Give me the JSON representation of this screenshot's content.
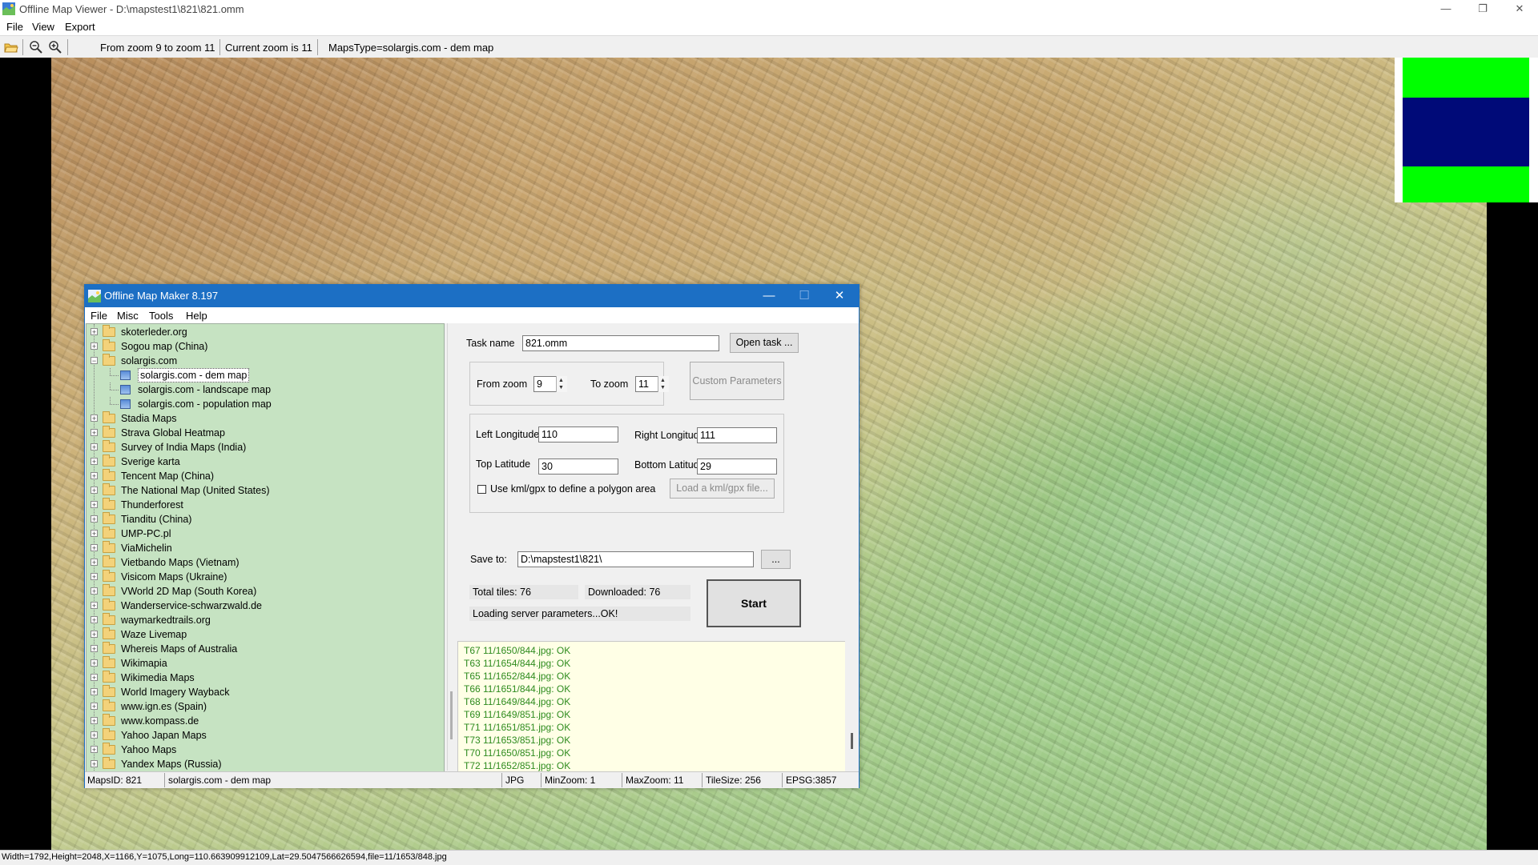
{
  "window": {
    "title": "Offline Map Viewer - D:\\mapstest1\\821\\821.omm",
    "controls": {
      "minimize": "—",
      "maximize": "❐",
      "close": "✕"
    }
  },
  "menu": {
    "file": "File",
    "view": "View",
    "export": "Export"
  },
  "toolbar": {
    "zoom_range": "From zoom 9 to zoom 11",
    "current_zoom": "Current zoom is 11",
    "maps_type": "MapsType=solargis.com - dem map"
  },
  "statusbar": {
    "text": "Width=1792,Height=2048,X=1166,Y=1075,Long=110.663909912109,Lat=29.5047566626594,file=11/1653/848.jpg"
  },
  "overview_colors": {
    "top": "#00ff00",
    "middle": "#000a78",
    "bottom": "#00ff00"
  },
  "dialog": {
    "title": "Offline Map Maker 8.197",
    "controls": {
      "minimize": "—",
      "maximize": "☐",
      "close": "✕"
    },
    "menu": {
      "file": "File",
      "misc": "Misc",
      "tools": "Tools",
      "help": "Help"
    },
    "tree": {
      "items": [
        {
          "label": "skoterleder.org"
        },
        {
          "label": "Sogou map (China)"
        },
        {
          "label": "solargis.com",
          "expanded": true
        },
        {
          "label": "solargis.com - dem map",
          "child": true,
          "selected": true
        },
        {
          "label": "solargis.com - landscape map",
          "child": true
        },
        {
          "label": "solargis.com - population map",
          "child": true
        },
        {
          "label": "Stadia Maps"
        },
        {
          "label": "Strava Global Heatmap"
        },
        {
          "label": "Survey of India Maps (India)"
        },
        {
          "label": "Sverige karta"
        },
        {
          "label": "Tencent Map (China)"
        },
        {
          "label": "The National Map (United States)"
        },
        {
          "label": "Thunderforest"
        },
        {
          "label": "Tianditu (China)"
        },
        {
          "label": "UMP-PC.pl"
        },
        {
          "label": "ViaMichelin"
        },
        {
          "label": "Vietbando Maps (Vietnam)"
        },
        {
          "label": "Visicom Maps (Ukraine)"
        },
        {
          "label": "VWorld 2D Map (South Korea)"
        },
        {
          "label": "Wanderservice-schwarzwald.de"
        },
        {
          "label": "waymarkedtrails.org"
        },
        {
          "label": "Waze Livemap"
        },
        {
          "label": "Whereis Maps of Australia"
        },
        {
          "label": "Wikimapia"
        },
        {
          "label": "Wikimedia Maps"
        },
        {
          "label": "World Imagery Wayback"
        },
        {
          "label": "www.ign.es (Spain)"
        },
        {
          "label": "www.kompass.de"
        },
        {
          "label": "Yahoo Japan Maps"
        },
        {
          "label": "Yahoo Maps"
        },
        {
          "label": "Yandex Maps (Russia)"
        }
      ]
    },
    "task": {
      "label": "Task name",
      "value": "821.omm",
      "open_button": "Open task ..."
    },
    "zoom": {
      "from_label": "From zoom",
      "from_value": "9",
      "to_label": "To zoom",
      "to_value": "11",
      "custom_button": "Custom Parameters"
    },
    "area": {
      "left_lon_label": "Left Longitude",
      "left_lon": "110",
      "right_lon_label": "Right Longitude",
      "right_lon": "111",
      "top_lat_label": "Top Latitude",
      "top_lat": "30",
      "bottom_lat_label": "Bottom Latitude",
      "bottom_lat": "29",
      "kml_checkbox_label": "Use kml/gpx to define a polygon area",
      "kml_checked": false,
      "load_kml_button": "Load a kml/gpx file..."
    },
    "save": {
      "label": "Save to:",
      "value": "D:\\mapstest1\\821\\",
      "browse_button": "..."
    },
    "progress": {
      "total": "Total tiles: 76",
      "downloaded": "Downloaded: 76",
      "status": "Loading server parameters...OK!"
    },
    "start_button": "Start",
    "log": [
      "T67 11/1650/844.jpg: OK",
      "T63 11/1654/844.jpg: OK",
      "T65 11/1652/844.jpg: OK",
      "T66 11/1651/844.jpg: OK",
      "T68 11/1649/844.jpg: OK",
      "T69 11/1649/851.jpg: OK",
      "T71 11/1651/851.jpg: OK",
      "T73 11/1653/851.jpg: OK",
      "T70 11/1650/851.jpg: OK",
      "T72 11/1652/851.jpg: OK"
    ],
    "status": {
      "maps_id": "MapsID:  821",
      "map_name": "solargis.com - dem map",
      "format": "JPG",
      "min_zoom": "MinZoom: 1",
      "max_zoom": "MaxZoom: 11",
      "tile_size": "TileSize: 256",
      "epsg": "EPSG:3857"
    }
  }
}
